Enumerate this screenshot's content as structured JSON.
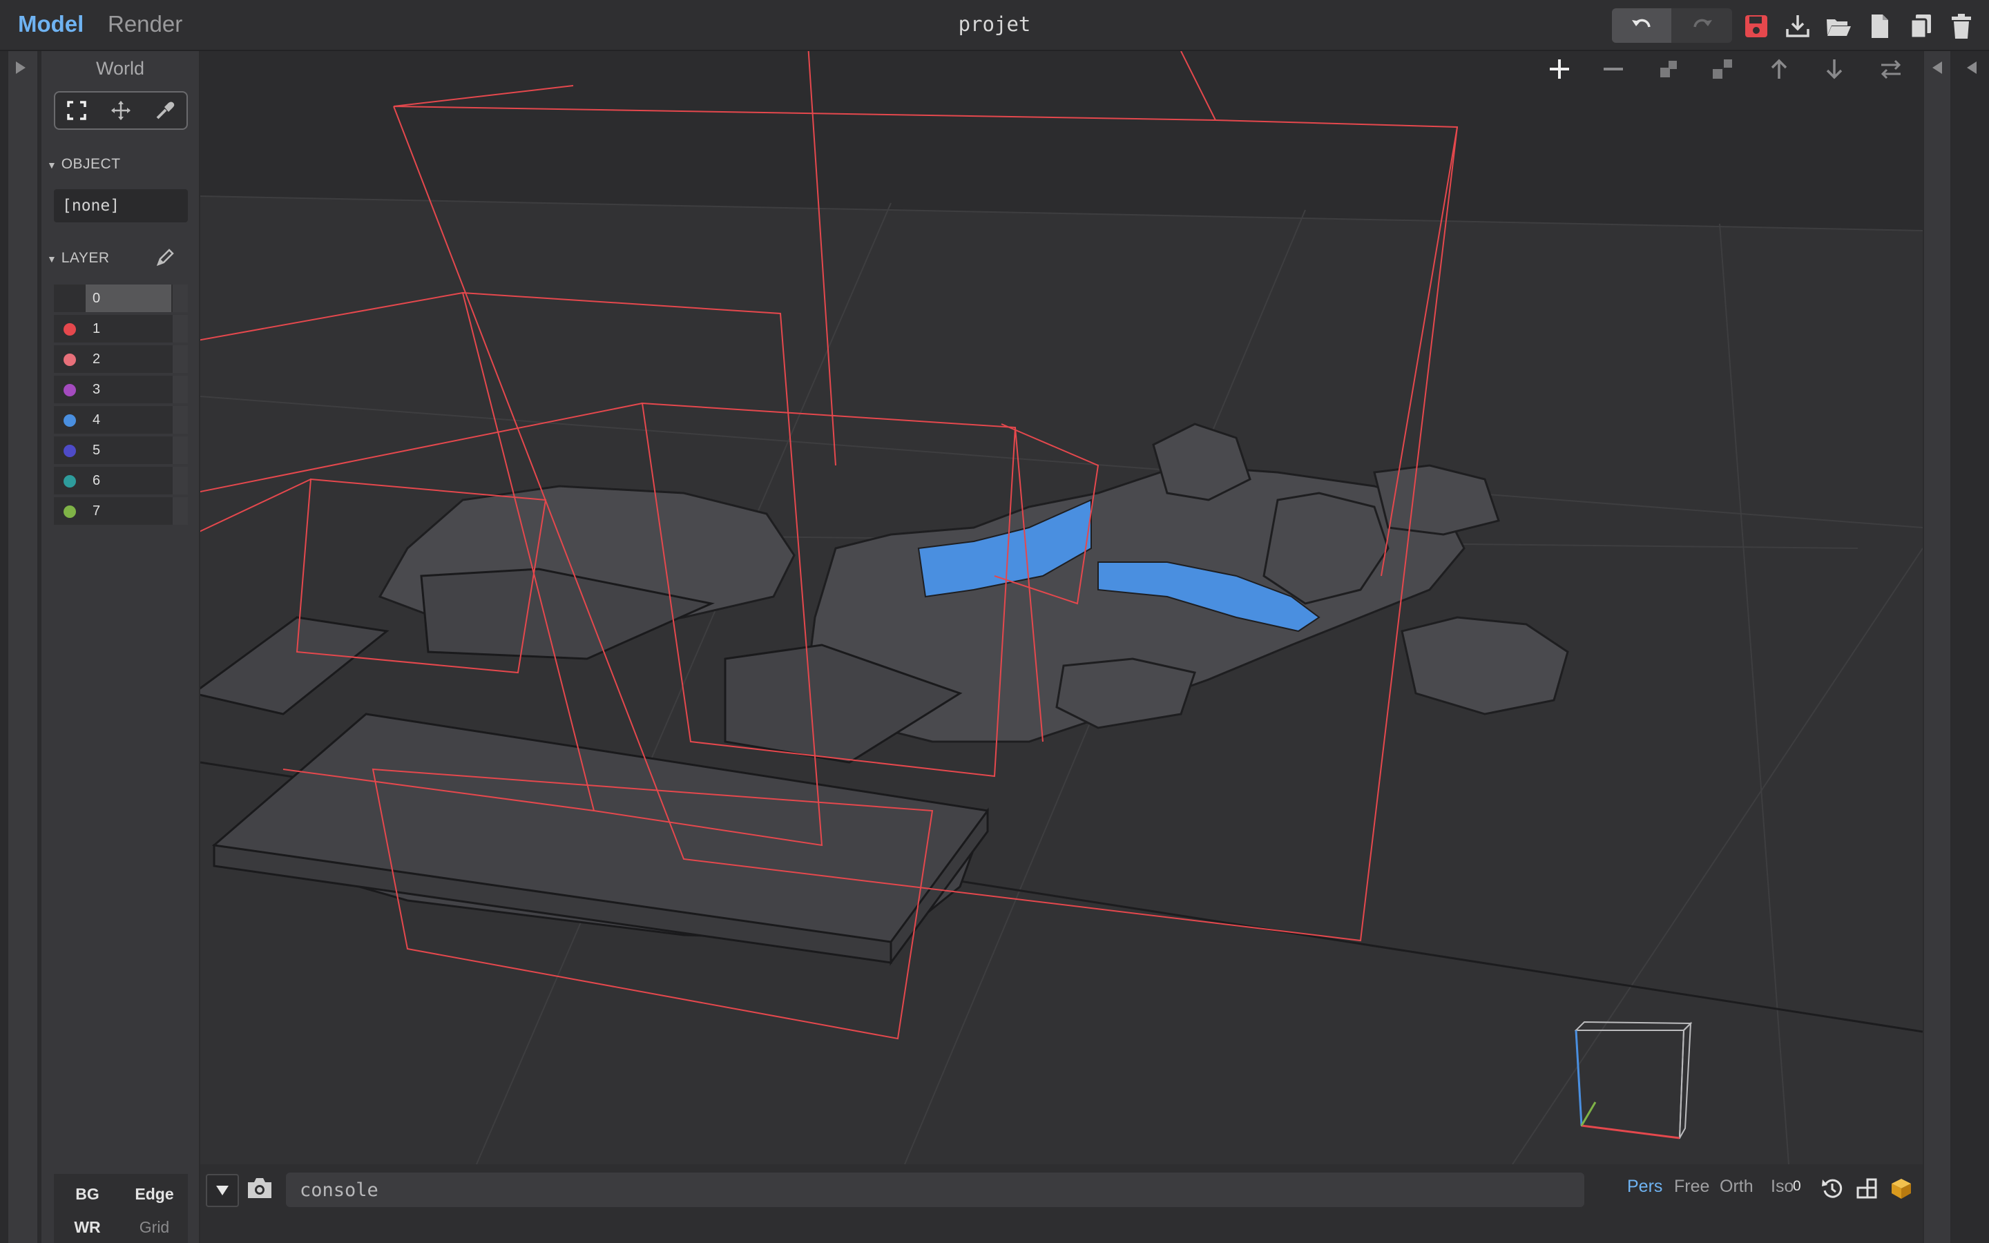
{
  "header": {
    "tabs": [
      {
        "label": "Model",
        "active": true
      },
      {
        "label": "Render",
        "active": false
      }
    ],
    "title": "projet",
    "actions": [
      "undo-icon",
      "redo-icon",
      "save-icon",
      "download-icon",
      "open-folder-icon",
      "new-file-icon",
      "duplicate-icon",
      "trash-icon"
    ]
  },
  "sidebar": {
    "title": "World",
    "tools": [
      "select-icon",
      "move-icon",
      "eyedropper-icon"
    ],
    "object": {
      "heading": "OBJECT",
      "value": "[none]"
    },
    "layer": {
      "heading": "LAYER",
      "items": [
        {
          "label": "0",
          "color": "",
          "active": true
        },
        {
          "label": "1",
          "color": "#e5484d"
        },
        {
          "label": "2",
          "color": "#e8707a"
        },
        {
          "label": "3",
          "color": "#a44bbf"
        },
        {
          "label": "4",
          "color": "#4a8fe0"
        },
        {
          "label": "5",
          "color": "#4e4bc8"
        },
        {
          "label": "6",
          "color": "#2e9c9c"
        },
        {
          "label": "7",
          "color": "#7fb347"
        }
      ]
    },
    "toggles": {
      "bg": "BG",
      "edge": "Edge",
      "wr": "WR",
      "grid": "Grid"
    }
  },
  "viewport": {
    "toolbar": [
      "plus-icon",
      "minus-icon",
      "shrink-icon",
      "expand-icon",
      "arrow-up-icon",
      "arrow-down-icon",
      "swap-icon"
    ],
    "colors": {
      "bounds": "#e5484d",
      "voxel": "#4a4a4e",
      "water": "#4a8fe0",
      "grid": "#3c3c3e"
    }
  },
  "console": {
    "placeholder": "console",
    "view_modes": [
      {
        "label": "Pers",
        "active": true
      },
      {
        "label": "Free",
        "active": false
      },
      {
        "label": "Orth",
        "active": false
      },
      {
        "label": "Iso",
        "active": false
      }
    ],
    "zoom": "0"
  }
}
